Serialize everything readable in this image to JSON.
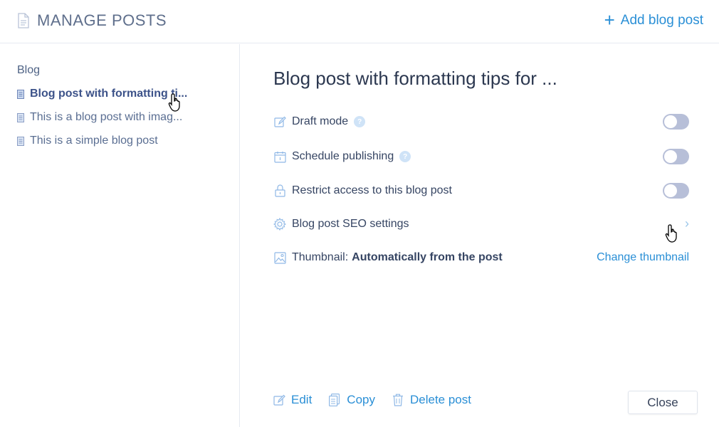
{
  "header": {
    "title": "MANAGE POSTS",
    "icon": "document-icon",
    "add_button_label": "Add blog post"
  },
  "sidebar": {
    "section_label": "Blog",
    "items": [
      {
        "label": "Blog post with formatting ti...",
        "active": true
      },
      {
        "label": "This is a blog post with imag...",
        "active": false
      },
      {
        "label": "This is a simple blog post",
        "active": false
      }
    ]
  },
  "main": {
    "post_title": "Blog post with formatting tips for ...",
    "settings": [
      {
        "label": "Draft mode",
        "icon": "pencil-icon",
        "control": "toggle",
        "on": false,
        "help": true
      },
      {
        "label": "Schedule publishing",
        "icon": "calendar-icon",
        "control": "toggle",
        "on": false,
        "help": true
      },
      {
        "label": "Restrict access to this blog post",
        "icon": "lock-icon",
        "control": "toggle",
        "on": false,
        "help": false
      },
      {
        "label": "Blog post SEO settings",
        "icon": "gear-icon",
        "control": "chevron",
        "help": false
      }
    ],
    "thumbnail": {
      "label": "Thumbnail:",
      "value": "Automatically from the post",
      "action": "Change thumbnail",
      "icon": "image-icon"
    }
  },
  "footer": {
    "edit": "Edit",
    "copy": "Copy",
    "delete": "Delete post",
    "close": "Close"
  },
  "colors": {
    "accent": "#2a8fd6",
    "toggle_off": "#b7bfd8",
    "active_text": "#3c5289"
  }
}
